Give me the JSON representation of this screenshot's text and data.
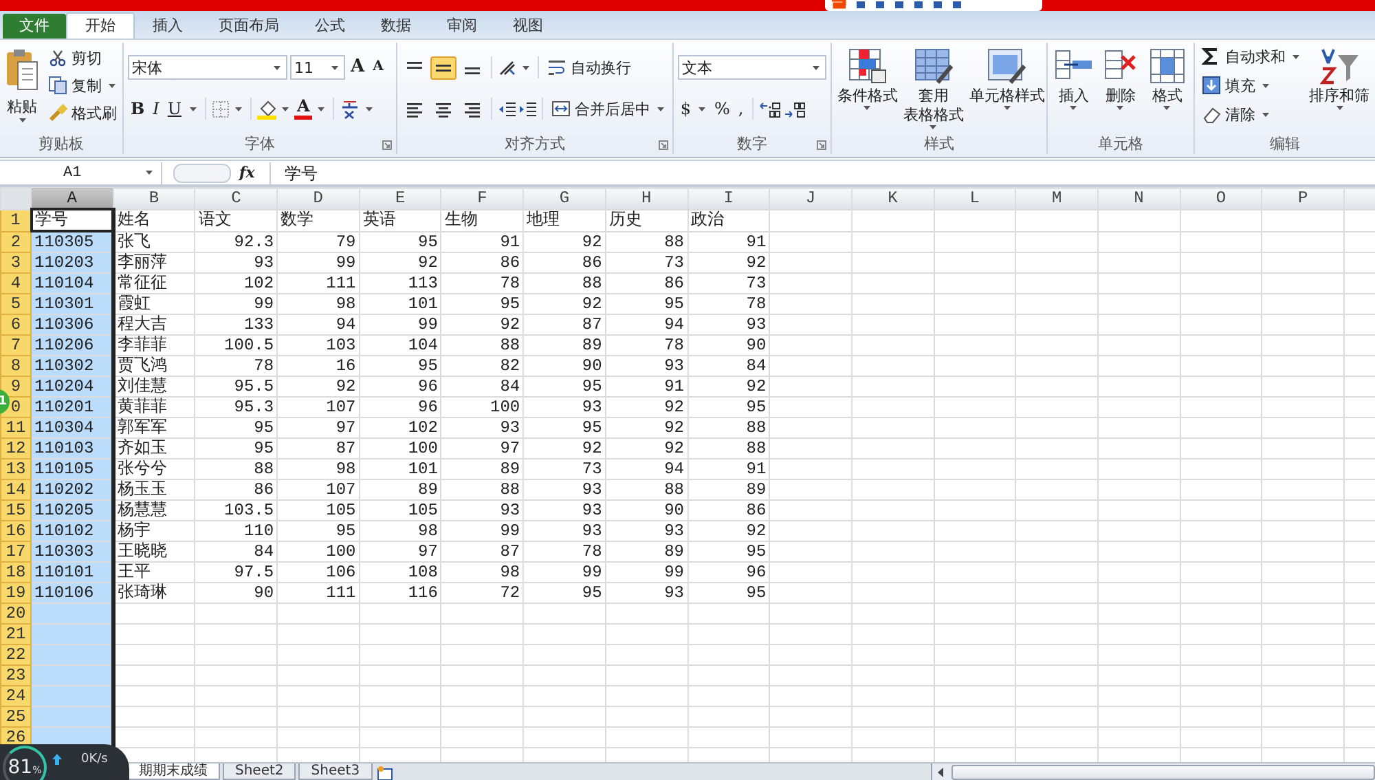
{
  "ribbon_tabs": [
    {
      "label": "文件",
      "kind": "file",
      "selected": false
    },
    {
      "label": "开始",
      "kind": "tab",
      "selected": true
    },
    {
      "label": "插入",
      "kind": "tab",
      "selected": false
    },
    {
      "label": "页面布局",
      "kind": "tab",
      "selected": false
    },
    {
      "label": "公式",
      "kind": "tab",
      "selected": false
    },
    {
      "label": "数据",
      "kind": "tab",
      "selected": false
    },
    {
      "label": "审阅",
      "kind": "tab",
      "selected": false
    },
    {
      "label": "视图",
      "kind": "tab",
      "selected": false
    }
  ],
  "ribbon_groups": [
    {
      "kind": "clipboard",
      "label": "剪贴板",
      "paste": "粘贴",
      "cut": "剪切",
      "copy": "复制",
      "format_painter": "格式刷"
    },
    {
      "kind": "font",
      "label": "字体",
      "font_name": "宋体",
      "font_size": "11",
      "grow": "A",
      "shrink": "A",
      "bold": "B",
      "italic": "I",
      "underline": "U",
      "font_color": "A"
    },
    {
      "kind": "alignment",
      "label": "对齐方式",
      "vertical_align": [
        {
          "selected": false
        },
        {
          "selected": true
        },
        {
          "selected": false
        }
      ],
      "wrap_text": "自动换行",
      "merge_center": "合并后居中"
    },
    {
      "kind": "number",
      "label": "数字",
      "format": "文本",
      "currency": "$",
      "percent": "%",
      "comma": ","
    },
    {
      "kind": "styles",
      "label": "样式",
      "buttons": [
        {
          "label_lines": [
            "条件格式"
          ]
        },
        {
          "label_lines": [
            "套用",
            "表格格式"
          ]
        },
        {
          "label_lines": [
            "单元格样式"
          ]
        }
      ]
    },
    {
      "kind": "cells",
      "label": "单元格",
      "buttons": [
        {
          "label_lines": [
            "插入"
          ]
        },
        {
          "label_lines": [
            "删除"
          ]
        },
        {
          "label_lines": [
            "格式"
          ]
        }
      ]
    },
    {
      "kind": "editing",
      "label": "编辑",
      "autosum": "自动求和",
      "fill": "填充",
      "clear": "清除",
      "sort_filter": "排序和筛"
    }
  ],
  "formula_bar": {
    "name_box": "A1",
    "fx": "fx",
    "value": "学号"
  },
  "sheet": {
    "columns": [
      {
        "label": "A",
        "selected": true
      },
      {
        "label": "B",
        "selected": false
      },
      {
        "label": "C",
        "selected": false
      },
      {
        "label": "D",
        "selected": false
      },
      {
        "label": "E",
        "selected": false
      },
      {
        "label": "F",
        "selected": false
      },
      {
        "label": "G",
        "selected": false
      },
      {
        "label": "H",
        "selected": false
      },
      {
        "label": "I",
        "selected": false
      },
      {
        "label": "J",
        "selected": false
      },
      {
        "label": "K",
        "selected": false
      },
      {
        "label": "L",
        "selected": false
      },
      {
        "label": "M",
        "selected": false
      },
      {
        "label": "N",
        "selected": false
      },
      {
        "label": "O",
        "selected": false
      },
      {
        "label": "P",
        "selected": false
      }
    ],
    "rows": [
      {
        "number": "1",
        "kind": "header",
        "cells": [
          "学号",
          "姓名",
          "语文",
          "数学",
          "英语",
          "生物",
          "地理",
          "历史",
          "政治"
        ]
      },
      {
        "number": "2",
        "kind": "data",
        "cells": [
          "110305",
          "张飞",
          "92.3",
          "79",
          "95",
          "91",
          "92",
          "88",
          "91"
        ]
      },
      {
        "number": "3",
        "kind": "data",
        "cells": [
          "110203",
          "李丽萍",
          "93",
          "99",
          "92",
          "86",
          "86",
          "73",
          "92"
        ]
      },
      {
        "number": "4",
        "kind": "data",
        "cells": [
          "110104",
          "常征征",
          "102",
          "111",
          "113",
          "78",
          "88",
          "86",
          "73"
        ]
      },
      {
        "number": "5",
        "kind": "data",
        "cells": [
          "110301",
          "霞虹",
          "99",
          "98",
          "101",
          "95",
          "92",
          "95",
          "78"
        ]
      },
      {
        "number": "6",
        "kind": "data",
        "cells": [
          "110306",
          "程大吉",
          "133",
          "94",
          "99",
          "92",
          "87",
          "94",
          "93"
        ]
      },
      {
        "number": "7",
        "kind": "data",
        "cells": [
          "110206",
          "李菲菲",
          "100.5",
          "103",
          "104",
          "88",
          "89",
          "78",
          "90"
        ]
      },
      {
        "number": "8",
        "kind": "data",
        "cells": [
          "110302",
          "贾飞鸿",
          "78",
          "16",
          "95",
          "82",
          "90",
          "93",
          "84"
        ]
      },
      {
        "number": "9",
        "kind": "data",
        "cells": [
          "110204",
          "刘佳慧",
          "95.5",
          "92",
          "96",
          "84",
          "95",
          "91",
          "92"
        ]
      },
      {
        "number": "0",
        "kind": "data",
        "cells": [
          "110201",
          "黄菲菲",
          "95.3",
          "107",
          "96",
          "100",
          "93",
          "92",
          "95"
        ]
      },
      {
        "number": "11",
        "kind": "data",
        "cells": [
          "110304",
          "郭军军",
          "95",
          "97",
          "102",
          "93",
          "95",
          "92",
          "88"
        ]
      },
      {
        "number": "12",
        "kind": "data",
        "cells": [
          "110103",
          "齐如玉",
          "95",
          "87",
          "100",
          "97",
          "92",
          "92",
          "88"
        ]
      },
      {
        "number": "13",
        "kind": "data",
        "cells": [
          "110105",
          "张兮兮",
          "88",
          "98",
          "101",
          "89",
          "73",
          "94",
          "91"
        ]
      },
      {
        "number": "14",
        "kind": "data",
        "cells": [
          "110202",
          "杨玉玉",
          "86",
          "107",
          "89",
          "88",
          "93",
          "88",
          "89"
        ]
      },
      {
        "number": "15",
        "kind": "data",
        "cells": [
          "110205",
          "杨慧慧",
          "103.5",
          "105",
          "105",
          "93",
          "93",
          "90",
          "86"
        ]
      },
      {
        "number": "16",
        "kind": "data",
        "cells": [
          "110102",
          "杨宇",
          "110",
          "95",
          "98",
          "99",
          "93",
          "93",
          "92"
        ]
      },
      {
        "number": "17",
        "kind": "data",
        "cells": [
          "110303",
          "王晓晓",
          "84",
          "100",
          "97",
          "87",
          "78",
          "89",
          "95"
        ]
      },
      {
        "number": "18",
        "kind": "data",
        "cells": [
          "110101",
          "王平",
          "97.5",
          "106",
          "108",
          "98",
          "99",
          "99",
          "96"
        ]
      },
      {
        "number": "19",
        "kind": "data",
        "cells": [
          "110106",
          "张琦琳",
          "90",
          "111",
          "116",
          "72",
          "95",
          "93",
          "95"
        ]
      },
      {
        "number": "20",
        "kind": "empty"
      },
      {
        "number": "21",
        "kind": "empty"
      },
      {
        "number": "22",
        "kind": "empty"
      },
      {
        "number": "23",
        "kind": "empty"
      },
      {
        "number": "24",
        "kind": "empty"
      },
      {
        "number": "25",
        "kind": "empty"
      },
      {
        "number": "26",
        "kind": "empty"
      }
    ]
  },
  "sheet_tabs": [
    {
      "label": "期期末成绩",
      "selected": true
    },
    {
      "label": "Sheet2",
      "selected": false
    },
    {
      "label": "Sheet3",
      "selected": false
    }
  ],
  "side_badge": "1",
  "net_widget": {
    "percent": "81",
    "percent_sign": "%",
    "speed": "0K/s"
  }
}
